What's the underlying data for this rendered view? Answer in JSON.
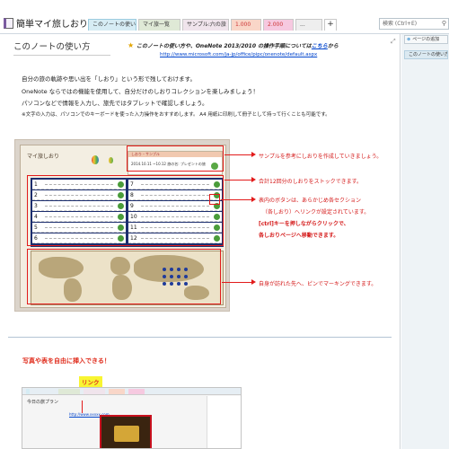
{
  "notebook": {
    "name": "簡単マイ旅しおり"
  },
  "tabs": [
    {
      "label": "このノートの使い方"
    },
    {
      "label": "マイ旅一覧"
    },
    {
      "label": "サンプル:六の旅"
    },
    {
      "label": "1.000"
    },
    {
      "label": "2.000"
    },
    {
      "label": "..."
    },
    {
      "label": "+"
    }
  ],
  "search": {
    "placeholder": "検索 (Ctrl+E)"
  },
  "page": {
    "title": "このノートの使い方",
    "note_pre": "このノートの使い方や、OneNote 2013/2010 の操作手順については",
    "note_link": "こちら",
    "note_post": "から",
    "url": "http://www.microsoft.com/ja-jp/office/pipc/onenote/default.aspx",
    "intro": [
      "自分の旅の軌跡や思い出を「しおり」という形で残しておけます。",
      "OneNote ならではの機能を使用して、自分だけのしおりコレクションを楽しみましょう！",
      "パソコンなどで情報を入力し、旅先ではタブレットで確認しましょう。",
      "※文字の入力は、パソコンでのキーボードを使った入力操作をおすすめします。 A4 用紙に印刷して冊子として持って行くことも可能です。"
    ]
  },
  "board": {
    "title": "マイ旅しおり",
    "sample_header": "しおり・サンプル",
    "sample_line": "2014.10.11 ~10.12  旅の名: プレゼントの旅",
    "numbers": [
      "1",
      "2",
      "3",
      "4",
      "5",
      "6",
      "7",
      "8",
      "9",
      "10",
      "11",
      "12"
    ]
  },
  "annotations": {
    "sample": "サンプルを参考にしおりを作成していきましょう。",
    "stock": "合計12回分のしおりをストックできます。",
    "button1": "表内のボタンは、あらかじめ各セクション",
    "button2": "（各しおり）へリンクが設定されています。",
    "button3": "[ctrl]キーを押しながらクリックで、",
    "button4": "各しおりページへ移動できます。",
    "map": "自身が訪れた先へ、ピンでマーキングできます。"
  },
  "bottom": {
    "heading": "写真や表を自由に挿入できる！",
    "link_label": "リンク",
    "shot_title": "今日の旅プラン",
    "shot_link": "http://www.xxxxx.com"
  },
  "right_panel": {
    "add_page": "ページの追加",
    "page_item": "このノートの使い方"
  },
  "colors": {
    "accent_red": "#e21b1b",
    "grid_navy": "#1c2e6e",
    "highlight_yellow": "#f8f532"
  }
}
